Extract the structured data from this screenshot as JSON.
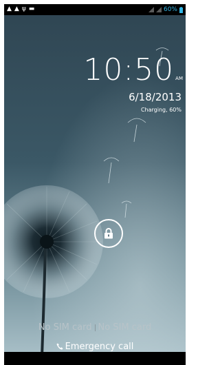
{
  "status_bar": {
    "battery_percent": "60%",
    "left_icons": [
      "warning-icon",
      "warning-icon",
      "usb-icon",
      "gamepad-icon"
    ],
    "right_icons": [
      "signal-icon",
      "signal-icon",
      "battery-icon"
    ]
  },
  "clock": {
    "time": "10:50",
    "ampm": "AM",
    "date": "6/18/2013",
    "charging_status": "Charging, 60%"
  },
  "lock": {
    "icon": "lock-icon"
  },
  "sim": {
    "slot1": "No SIM card",
    "slot2": "No SIM card"
  },
  "emergency": {
    "label": "Emergency call",
    "icon": "phone-icon"
  },
  "colors": {
    "accent": "#33b5e5",
    "wallpaper_top": "#2f4552",
    "wallpaper_bottom": "#a9c0c8"
  }
}
